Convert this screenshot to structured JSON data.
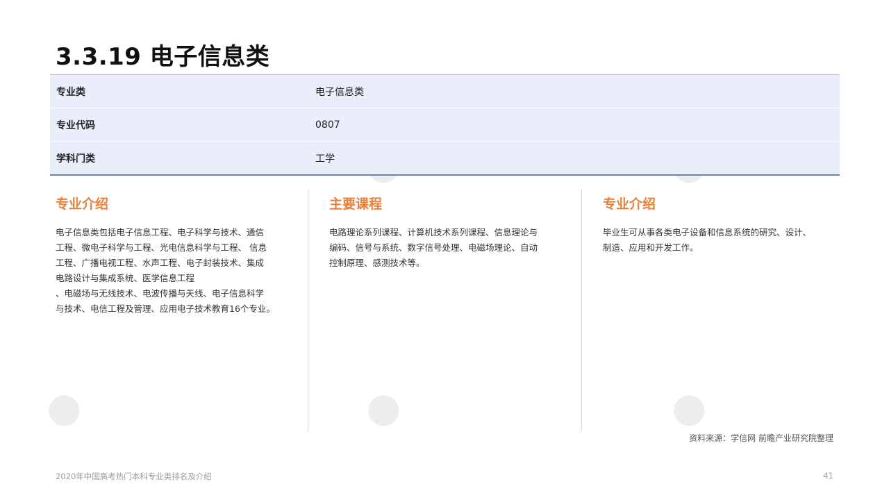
{
  "header": {
    "title": "3.3.19 电子信息类"
  },
  "info_table": {
    "rows": [
      {
        "label": "专业类",
        "value": "电子信息类"
      },
      {
        "label": "专业代码",
        "value": "0807"
      },
      {
        "label": "学科门类",
        "value": "工学"
      }
    ]
  },
  "columns": [
    {
      "heading": "专业介绍",
      "text": "电子信息类包括电子信息工程、电子科学与技术、通信\n工程、微电子科学与工程、光电信息科学与工程、 信息\n工程、广播电视工程、水声工程、电子封装技术、集成\n电路设计与集成系统、医学信息工程\n、电磁场与无线技术、电波传播与天线、电子信息科学\n与技术、电信工程及管理、应用电子技术教育16个专业。"
    },
    {
      "heading": "主要课程",
      "text": "电路理论系列课程、计算机技术系列课程、信息理论与\n编码、信号与系统、数字信号处理、电磁场理论、自动\n控制原理、感测技术等。"
    },
    {
      "heading": "专业介绍",
      "text": "毕业生可从事各类电子设备和信息系统的研究、设计、\n制造、应用和开发工作。"
    }
  ],
  "source_note": "资料来源：学信网 前瞻产业研究院整理",
  "footer": {
    "doc_title": "2020年中国高考热门本科专业类排名及介绍",
    "page_number": "41"
  },
  "watermark": {
    "brand": "前瞻产业研究院",
    "color": "#333333"
  }
}
